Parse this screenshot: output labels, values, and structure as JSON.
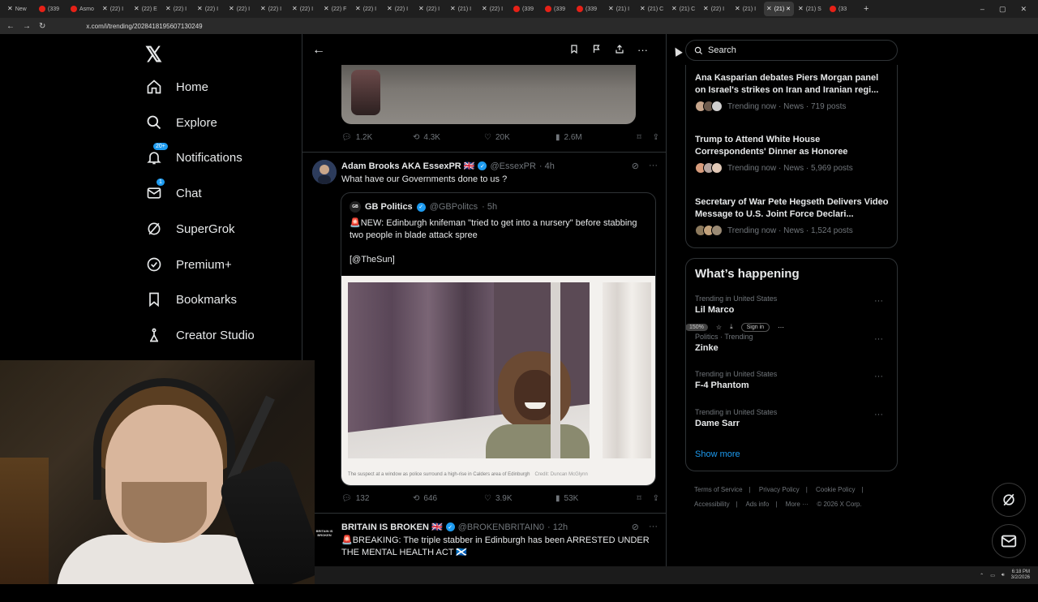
{
  "browser": {
    "tabs": [
      {
        "label": "New",
        "icon": "x"
      },
      {
        "label": "(339",
        "icon": "yt"
      },
      {
        "label": "Asmo",
        "icon": "yt"
      },
      {
        "label": "(22) I",
        "icon": "x"
      },
      {
        "label": "(22) E",
        "icon": "x"
      },
      {
        "label": "(22) I",
        "icon": "x"
      },
      {
        "label": "(22) I",
        "icon": "x"
      },
      {
        "label": "(22) I",
        "icon": "x"
      },
      {
        "label": "(22) I",
        "icon": "x"
      },
      {
        "label": "(22) I",
        "icon": "x"
      },
      {
        "label": "(22) F",
        "icon": "x"
      },
      {
        "label": "(22) I",
        "icon": "x"
      },
      {
        "label": "(22) I",
        "icon": "x"
      },
      {
        "label": "(22) I",
        "icon": "x"
      },
      {
        "label": "(21) I",
        "icon": "x"
      },
      {
        "label": "(22) I",
        "icon": "x"
      },
      {
        "label": "(339",
        "icon": "yt"
      },
      {
        "label": "(339",
        "icon": "yt"
      },
      {
        "label": "(339",
        "icon": "yt"
      },
      {
        "label": "(21) I",
        "icon": "x"
      },
      {
        "label": "(21) C",
        "icon": "x"
      },
      {
        "label": "(21) C",
        "icon": "x"
      },
      {
        "label": "(22) I",
        "icon": "x"
      },
      {
        "label": "(21) I",
        "icon": "x"
      },
      {
        "label": "(21) ✕",
        "icon": "x",
        "active": true
      },
      {
        "label": "(21) S",
        "icon": "x"
      },
      {
        "label": "(33",
        "icon": "yt"
      }
    ],
    "url": "x.com/i/trending/2028418195607130249",
    "zoom": "150%",
    "sign_in": "Sign in"
  },
  "nav": {
    "logo": "𝕏",
    "items": [
      {
        "label": "Home",
        "icon": "home-icon"
      },
      {
        "label": "Explore",
        "icon": "search-icon"
      },
      {
        "label": "Notifications",
        "icon": "bell-icon",
        "badge": "20+"
      },
      {
        "label": "Chat",
        "icon": "mail-icon",
        "badge": "1"
      },
      {
        "label": "SuperGrok",
        "icon": "grok-icon"
      },
      {
        "label": "Premium+",
        "icon": "verified-icon"
      },
      {
        "label": "Bookmarks",
        "icon": "bookmark-icon"
      },
      {
        "label": "Creator Studio",
        "icon": "creator-icon"
      }
    ]
  },
  "feed": {
    "tweet1_metrics": {
      "replies": "1.2K",
      "reposts": "4.3K",
      "likes": "20K",
      "views": "2.6M"
    },
    "tweet2": {
      "name": "Adam Brooks AKA EssexPR 🇬🇧",
      "handle": "@EssexPR",
      "time": "· 4h",
      "text": "What have our Governments done to us ?",
      "quote": {
        "avatar": "GB",
        "name": "GB Politics",
        "handle": "@GBPolitcs",
        "time": "· 5h",
        "text1": "🚨NEW: Edinburgh knifeman \"tried to get into a nursery\" before stabbing two people in blade attack spree",
        "text2": "[@TheSun]",
        "caption": "The suspect at a window as police surround a high-rise in Calders area of Edinburgh",
        "credit": "Credit: Duncan McGlynn"
      },
      "metrics": {
        "replies": "132",
        "reposts": "646",
        "likes": "3.9K",
        "views": "53K"
      }
    },
    "tweet3": {
      "avatar_text": "BRITAIN IS BROKEN",
      "name": "BRITAIN IS BROKEN 🇬🇧",
      "handle": "@BROKENBRITAIN0",
      "time": "· 12h",
      "text": "🚨BREAKING: The triple stabber in Edinburgh has been ARRESTED UNDER THE MENTAL HEALTH ACT 🏴󠁧󠁢󠁳󠁣󠁴󠁿"
    }
  },
  "sidebar": {
    "search_placeholder": "Search",
    "news": [
      {
        "title": "Ana Kasparian debates Piers Morgan panel on Israel's strikes on Iran and Iranian regi...",
        "meta": "Trending now · News · 719 posts"
      },
      {
        "title": "Trump to Attend White House Correspondents' Dinner as Honoree",
        "meta": "Trending now · News · 5,969 posts"
      },
      {
        "title": "Secretary of War Pete Hegseth Delivers Video Message to U.S. Joint Force Declari...",
        "meta": "Trending now · News · 1,524 posts"
      }
    ],
    "happening_title": "What’s happening",
    "trends": [
      {
        "context": "Trending in United States",
        "topic": "Lil Marco"
      },
      {
        "context": "Politics · Trending",
        "topic": "Zinke"
      },
      {
        "context": "Trending in United States",
        "topic": "F-4 Phantom"
      },
      {
        "context": "Trending in United States",
        "topic": "Dame Sarr"
      }
    ],
    "show_more": "Show more",
    "footer": [
      "Terms of Service",
      "|",
      "Privacy Policy",
      "|",
      "Cookie Policy",
      "|",
      "Accessibility",
      "|",
      "Ads info",
      "|",
      "More ···",
      "© 2026 X Corp."
    ]
  },
  "taskbar": {
    "time": "6:18 PM",
    "date": "3/2/2026"
  }
}
